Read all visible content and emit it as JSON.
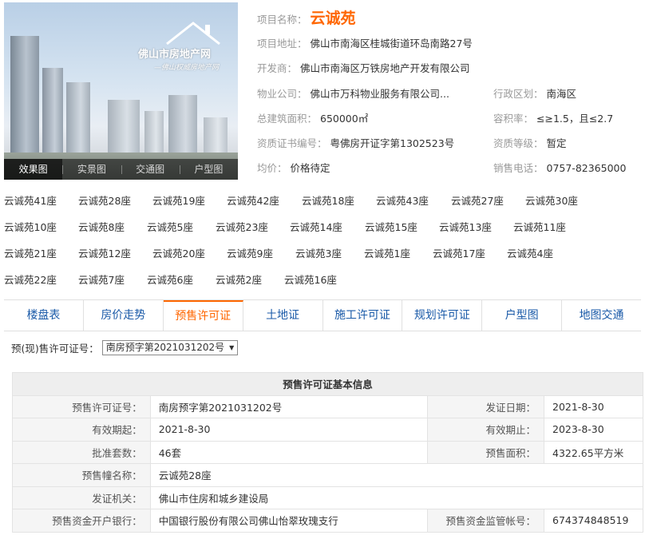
{
  "photo": {
    "logo_title": "佛山市房地产网",
    "logo_sub": "—佛山权威房地产网",
    "tabs": [
      "效果图",
      "实景图",
      "交通图",
      "户型图"
    ]
  },
  "project": {
    "name_label": "项目名称：",
    "name": "云诚苑",
    "address_label": "项目地址：",
    "address": "佛山市南海区桂城街道环岛南路27号",
    "developer_label": "开发商：",
    "developer": "佛山市南海区万铁房地产开发有限公司",
    "property_label": "物业公司：",
    "property": "佛山市万科物业服务有限公司...",
    "district_label": "行政区划：",
    "district": "南海区",
    "area_label": "总建筑面积：",
    "area": "650000㎡",
    "far_label": "容积率：",
    "far": "≤≥1.5，且≤2.7",
    "cert_label": "资质证书编号：",
    "cert": "粤佛房开证字第1302523号",
    "grade_label": "资质等级：",
    "grade": "暂定",
    "price_label": "均价：",
    "price": "价格待定",
    "phone_label": "销售电话：",
    "phone": "0757-82365000"
  },
  "buildings": [
    [
      "云诚苑41座",
      "云诚苑28座",
      "云诚苑19座",
      "云诚苑42座",
      "云诚苑18座",
      "云诚苑43座",
      "云诚苑27座",
      "云诚苑30座"
    ],
    [
      "云诚苑10座",
      "云诚苑8座",
      "云诚苑5座",
      "云诚苑23座",
      "云诚苑14座",
      "云诚苑15座",
      "云诚苑13座",
      "云诚苑11座"
    ],
    [
      "云诚苑21座",
      "云诚苑12座",
      "云诚苑20座",
      "云诚苑9座",
      "云诚苑3座",
      "云诚苑1座",
      "云诚苑17座",
      "云诚苑4座"
    ],
    [
      "云诚苑22座",
      "云诚苑7座",
      "云诚苑6座",
      "云诚苑2座",
      "云诚苑16座"
    ]
  ],
  "nav": {
    "tabs": [
      "楼盘表",
      "房价走势",
      "预售许可证",
      "土地证",
      "施工许可证",
      "规划许可证",
      "户型图",
      "地图交通"
    ],
    "active": "预售许可证"
  },
  "permit_select": {
    "label": "预(现)售许可证号：",
    "value": "南房预字第2021031202号"
  },
  "permit_table": {
    "title": "预售许可证基本信息",
    "permit_no_label": "预售许可证号：",
    "permit_no": "南房预字第2021031202号",
    "issue_date_label": "发证日期：",
    "issue_date": "2021-8-30",
    "valid_from_label": "有效期起：",
    "valid_from": "2021-8-30",
    "valid_to_label": "有效期止：",
    "valid_to": "2023-8-30",
    "units_label": "批准套数：",
    "units": "46套",
    "presale_area_label": "预售面积：",
    "presale_area": "4322.65平方米",
    "building_name_label": "预售幢名称：",
    "building_name": "云诚苑28座",
    "authority_label": "发证机关：",
    "authority": "佛山市住房和城乡建设局",
    "bank_label": "预售资金开户银行：",
    "bank": "中国银行股份有限公司佛山怡翠玫瑰支行",
    "account_label": "预售资金监管帐号：",
    "account": "674374848519"
  }
}
